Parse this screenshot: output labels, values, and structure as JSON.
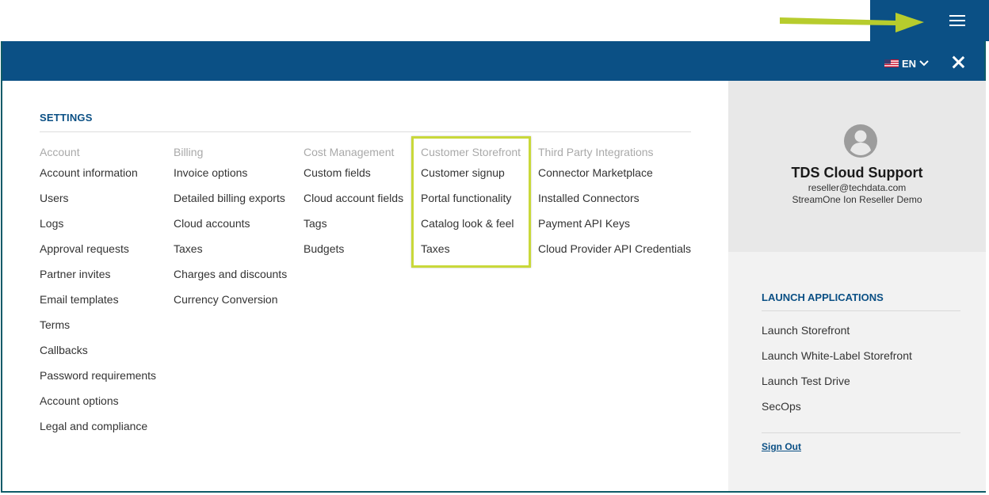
{
  "header": {
    "language": "EN"
  },
  "settings": {
    "title": "SETTINGS",
    "columns": [
      {
        "heading": "Account",
        "items": [
          "Account information",
          "Users",
          "Logs",
          "Approval requests",
          "Partner invites",
          "Email templates",
          "Terms",
          "Callbacks",
          "Password requirements",
          "Account options",
          "Legal and compliance"
        ]
      },
      {
        "heading": "Billing",
        "items": [
          "Invoice options",
          "Detailed billing exports",
          "Cloud accounts",
          "Taxes",
          "Charges and discounts",
          "Currency Conversion"
        ]
      },
      {
        "heading": "Cost Management",
        "items": [
          "Custom fields",
          "Cloud account fields",
          "Tags",
          "Budgets"
        ]
      },
      {
        "heading": "Customer Storefront",
        "items": [
          "Customer signup",
          "Portal functionality",
          "Catalog look & feel",
          "Taxes"
        ]
      },
      {
        "heading": "Third Party Integrations",
        "items": [
          "Connector Marketplace",
          "Installed Connectors",
          "Payment API Keys",
          "Cloud Provider API Credentials"
        ]
      }
    ]
  },
  "profile": {
    "name": "TDS Cloud Support",
    "email": "reseller@techdata.com",
    "organization": "StreamOne Ion Reseller Demo"
  },
  "launch": {
    "title": "LAUNCH APPLICATIONS",
    "items": [
      "Launch Storefront",
      "Launch White-Label Storefront",
      "Launch Test Drive",
      "SecOps"
    ],
    "sign_out": "Sign Out"
  },
  "colors": {
    "header_blue": "#0b5085",
    "highlight": "#c9d83a",
    "arrow": "#b7cc2d"
  }
}
